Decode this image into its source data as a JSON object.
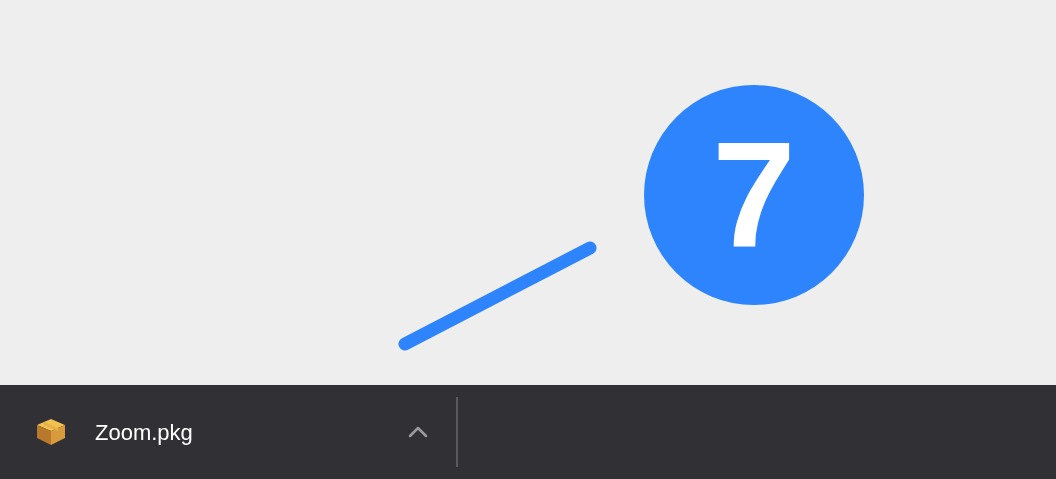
{
  "annotation": {
    "number": "7"
  },
  "download_bar": {
    "items": [
      {
        "filename": "Zoom.pkg"
      }
    ]
  }
}
